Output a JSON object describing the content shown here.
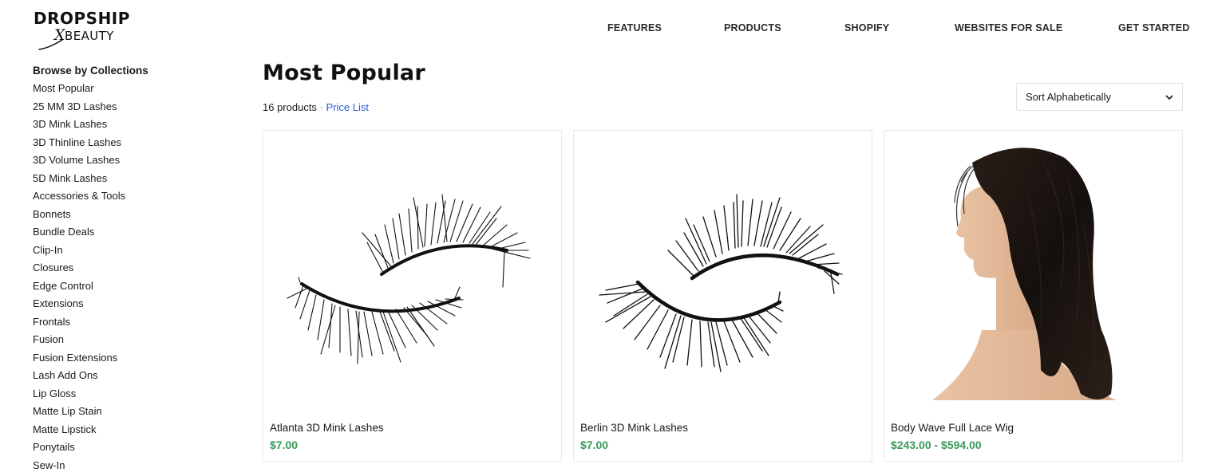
{
  "brand": {
    "logo_top": "DROPSHIP",
    "logo_x": "X",
    "logo_bottom": "BEAUTY"
  },
  "nav": {
    "features": "FEATURES",
    "products": "PRODUCTS",
    "shopify": "SHOPIFY",
    "websites_for_sale": "WEBSITES FOR SALE",
    "get_started": "GET STARTED"
  },
  "sidebar": {
    "heading": "Browse by Collections",
    "items": [
      {
        "label": "Most Popular"
      },
      {
        "label": "25 MM 3D Lashes"
      },
      {
        "label": "3D Mink Lashes"
      },
      {
        "label": "3D Thinline Lashes"
      },
      {
        "label": "3D Volume Lashes"
      },
      {
        "label": "5D Mink Lashes"
      },
      {
        "label": "Accessories & Tools"
      },
      {
        "label": "Bonnets"
      },
      {
        "label": "Bundle Deals"
      },
      {
        "label": "Clip-In"
      },
      {
        "label": "Closures"
      },
      {
        "label": "Edge Control"
      },
      {
        "label": "Extensions"
      },
      {
        "label": "Frontals"
      },
      {
        "label": "Fusion"
      },
      {
        "label": "Fusion Extensions"
      },
      {
        "label": "Lash Add Ons"
      },
      {
        "label": "Lip Gloss"
      },
      {
        "label": "Matte Lip Stain"
      },
      {
        "label": "Matte Lipstick"
      },
      {
        "label": "Ponytails"
      },
      {
        "label": "Sew-In"
      }
    ]
  },
  "main": {
    "title": "Most Popular",
    "product_count": "16 products",
    "separator": "·",
    "price_list_label": "Price List",
    "sort": {
      "selected": "Sort Alphabetically"
    },
    "products": [
      {
        "name": "Atlanta 3D Mink Lashes",
        "price": "$7.00",
        "image_icon": "lashes-image"
      },
      {
        "name": "Berlin 3D Mink Lashes",
        "price": "$7.00",
        "image_icon": "lashes-image"
      },
      {
        "name": "Body Wave Full Lace Wig",
        "price": "$243.00 - $594.00",
        "image_icon": "wig-mannequin-image"
      }
    ]
  },
  "colors": {
    "price_green": "#3a9a57",
    "link_blue": "#2a5bd7",
    "card_border": "#e9e9e9"
  }
}
